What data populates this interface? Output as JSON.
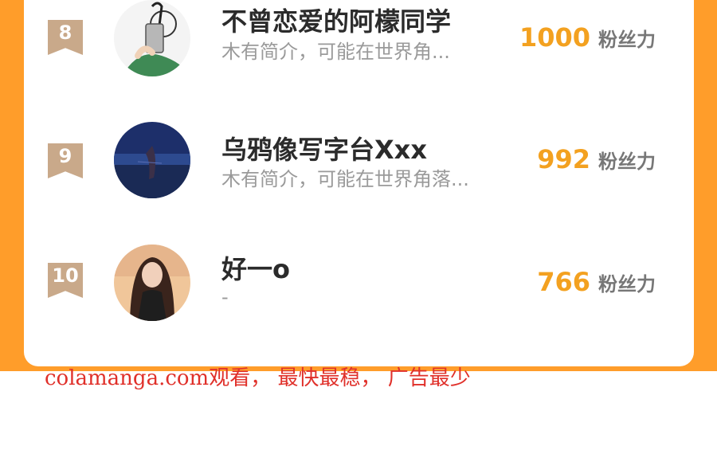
{
  "ranking": {
    "items": [
      {
        "rank": "8",
        "name": "不曾恋爱的阿檬同学",
        "bio": "木有简介，可能在世界角...",
        "fans_count": "1000",
        "fans_label": "粉丝力",
        "avatar_icon": "person-selfie-avatar"
      },
      {
        "rank": "9",
        "name": "乌鸦像写字台Xxx",
        "bio": "木有简介，可能在世界角落...",
        "fans_count": "992",
        "fans_label": "粉丝力",
        "avatar_icon": "ocean-photo-avatar"
      },
      {
        "rank": "10",
        "name": "好一o",
        "bio": "-",
        "fans_count": "766",
        "fans_label": "粉丝力",
        "avatar_icon": "portrait-avatar"
      }
    ]
  },
  "watermark": {
    "text": "colamanga.com观看， 最快最稳， 广告最少"
  },
  "colors": {
    "frame": "#ff9d2a",
    "fans_number": "#f3a120",
    "rank_badge": "#c9a98a",
    "watermark": "#e0302a"
  }
}
